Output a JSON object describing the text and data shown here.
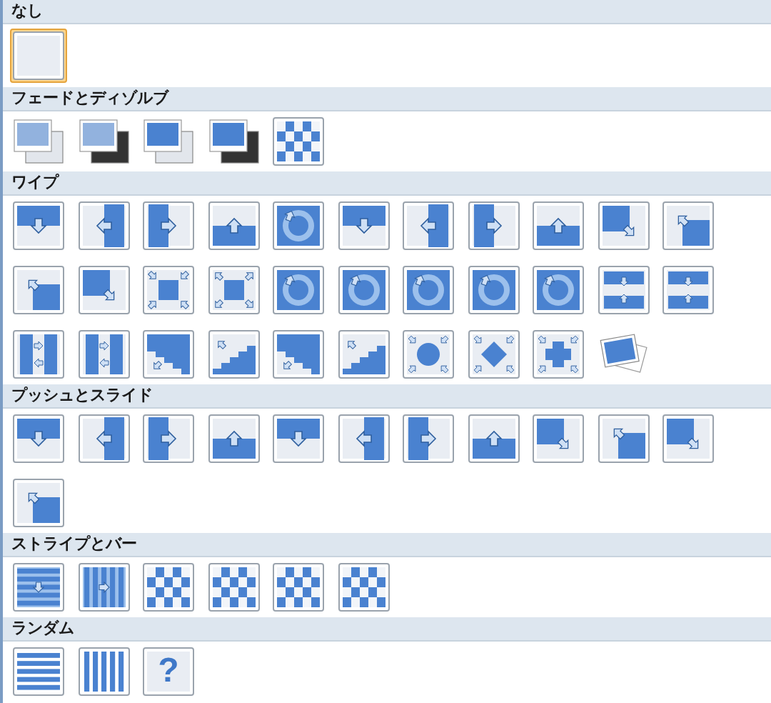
{
  "sections": [
    {
      "title": "なし",
      "items": [
        {
          "selected": true
        }
      ]
    },
    {
      "title": "フェードとディゾルブ",
      "items": [
        {
          "selected": false
        },
        {
          "selected": false
        },
        {
          "selected": false
        },
        {
          "selected": false
        },
        {
          "selected": false
        }
      ]
    },
    {
      "title": "ワイプ",
      "items": [
        {
          "selected": false
        },
        {
          "selected": false
        },
        {
          "selected": false
        },
        {
          "selected": false
        },
        {
          "selected": false
        },
        {
          "selected": false
        },
        {
          "selected": false
        },
        {
          "selected": false
        },
        {
          "selected": false
        },
        {
          "selected": false
        },
        {
          "selected": false
        },
        {
          "selected": false
        },
        {
          "selected": false
        },
        {
          "selected": false
        },
        {
          "selected": false
        },
        {
          "selected": false
        },
        {
          "selected": false
        },
        {
          "selected": false
        },
        {
          "selected": false
        },
        {
          "selected": false
        },
        {
          "selected": false
        },
        {
          "selected": false
        },
        {
          "selected": false
        },
        {
          "selected": false
        },
        {
          "selected": false
        },
        {
          "selected": false
        },
        {
          "selected": false
        },
        {
          "selected": false
        },
        {
          "selected": false
        },
        {
          "selected": false
        },
        {
          "selected": false
        },
        {
          "selected": false
        }
      ]
    },
    {
      "title": "プッシュとスライド",
      "items": [
        {
          "selected": false
        },
        {
          "selected": false
        },
        {
          "selected": false
        },
        {
          "selected": false
        },
        {
          "selected": false
        },
        {
          "selected": false
        },
        {
          "selected": false
        },
        {
          "selected": false
        },
        {
          "selected": false
        },
        {
          "selected": false
        },
        {
          "selected": false
        },
        {
          "selected": false
        }
      ]
    },
    {
      "title": "ストライプとバー",
      "items": [
        {
          "selected": false
        },
        {
          "selected": false
        },
        {
          "selected": false
        },
        {
          "selected": false
        },
        {
          "selected": false
        },
        {
          "selected": false
        }
      ]
    },
    {
      "title": "ランダム",
      "items": [
        {
          "selected": false
        },
        {
          "selected": false
        },
        {
          "selected": false,
          "glyph": "?"
        }
      ]
    }
  ]
}
